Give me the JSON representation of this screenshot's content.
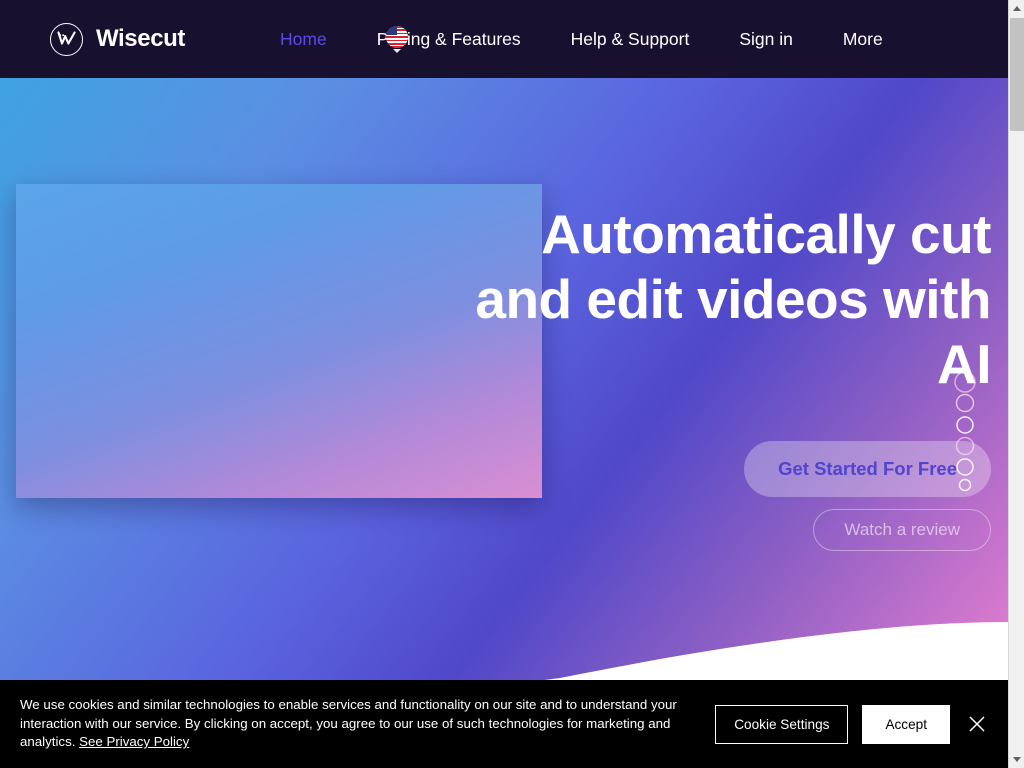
{
  "nav": {
    "brand": {
      "name": "Wisecut",
      "mark_icon": "wisecut-w-logo"
    },
    "links": [
      {
        "label": "Home",
        "active": true
      },
      {
        "label": "Pricing & Features",
        "active": false
      },
      {
        "label": "Help & Support",
        "active": false
      },
      {
        "label": "Sign in",
        "active": false
      },
      {
        "label": "More",
        "active": false
      }
    ],
    "language_selector": {
      "flag_icon": "us-flag-icon",
      "chevron_icon": "chevron-down-icon"
    },
    "background_color": "#17112f",
    "active_link_color": "#5b4ae8"
  },
  "hero": {
    "headline": "Automatically cut and edit videos with AI",
    "primary_cta": "Get Started For Free",
    "secondary_cta": "Watch a review",
    "media_placeholder_name": "hero-video",
    "decorative_icon": "circle-chain-decoration",
    "gradient_start": "#3fa3e2",
    "gradient_mid": "#5048c9",
    "gradient_end": "#e87fd0",
    "primary_cta_text_color": "#4f45cf"
  },
  "cookie_banner": {
    "message": "We use cookies and similar technologies to enable services and functionality on our site and to understand your interaction with our service. By clicking on accept, you agree to our use of such technologies for marketing and analytics. ",
    "privacy_link": "See Privacy Policy",
    "settings_button": "Cookie Settings",
    "accept_button": "Accept",
    "close_icon": "close-icon",
    "background_color": "#000000"
  },
  "scrollbar": {
    "up_icon": "scroll-up-arrow-icon",
    "down_icon": "scroll-down-arrow-icon",
    "thumb_name": "scrollbar-thumb"
  }
}
